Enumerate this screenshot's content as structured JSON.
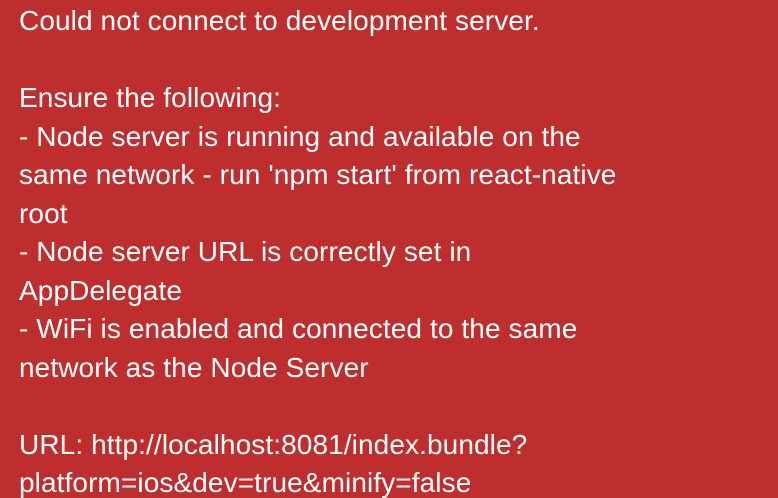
{
  "redbox": {
    "background_color": "#bf2e2e",
    "text_color": "#ffffff",
    "title": "Could not connect to development server.",
    "intro": "Ensure the following:",
    "items": [
      {
        "line1": "- Node server is running and available on the",
        "line2": "same network - run 'npm start' from react-native",
        "line3": "root"
      },
      {
        "line1": "- Node server URL is correctly set in",
        "line2": "AppDelegate"
      },
      {
        "line1": "- WiFi is enabled and connected to the same",
        "line2": "network as the Node Server"
      }
    ],
    "url_line1": "URL: http://localhost:8081/index.bundle?",
    "url_line2": "platform=ios&dev=true&minify=false"
  }
}
